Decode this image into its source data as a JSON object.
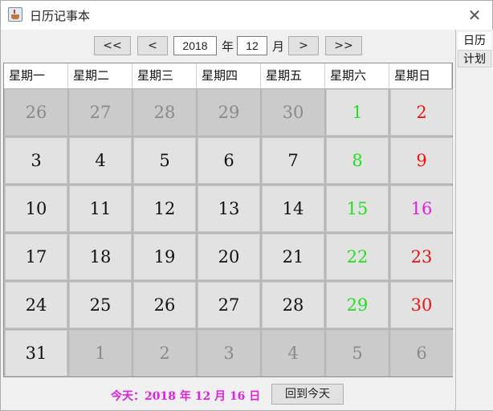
{
  "window": {
    "title": "日历记事本"
  },
  "nav": {
    "prev_year": "<<",
    "prev_month": "<",
    "year": "2018",
    "year_label": "年",
    "month": "12",
    "month_label": "月",
    "next_month": ">",
    "next_year": ">>"
  },
  "weekdays": [
    "星期一",
    "星期二",
    "星期三",
    "星期四",
    "星期五",
    "星期六",
    "星期日"
  ],
  "weeks": [
    [
      {
        "d": "26",
        "o": true
      },
      {
        "d": "27",
        "o": true
      },
      {
        "d": "28",
        "o": true
      },
      {
        "d": "29",
        "o": true
      },
      {
        "d": "30",
        "o": true
      },
      {
        "d": "1",
        "c": "#22e022"
      },
      {
        "d": "2",
        "c": "#ee1111"
      }
    ],
    [
      {
        "d": "3"
      },
      {
        "d": "4"
      },
      {
        "d": "5"
      },
      {
        "d": "6"
      },
      {
        "d": "7"
      },
      {
        "d": "8",
        "c": "#22e022"
      },
      {
        "d": "9",
        "c": "#ee1111"
      }
    ],
    [
      {
        "d": "10"
      },
      {
        "d": "11"
      },
      {
        "d": "12"
      },
      {
        "d": "13"
      },
      {
        "d": "14"
      },
      {
        "d": "15",
        "c": "#22e022"
      },
      {
        "d": "16",
        "c": "#e020e0"
      }
    ],
    [
      {
        "d": "17"
      },
      {
        "d": "18"
      },
      {
        "d": "19"
      },
      {
        "d": "20"
      },
      {
        "d": "21"
      },
      {
        "d": "22",
        "c": "#22e022"
      },
      {
        "d": "23",
        "c": "#ee1111"
      }
    ],
    [
      {
        "d": "24"
      },
      {
        "d": "25"
      },
      {
        "d": "26"
      },
      {
        "d": "27"
      },
      {
        "d": "28"
      },
      {
        "d": "29",
        "c": "#22e022"
      },
      {
        "d": "30",
        "c": "#ee1111"
      }
    ],
    [
      {
        "d": "31"
      },
      {
        "d": "1",
        "o": true
      },
      {
        "d": "2",
        "o": true
      },
      {
        "d": "3",
        "o": true
      },
      {
        "d": "4",
        "o": true
      },
      {
        "d": "5",
        "o": true
      },
      {
        "d": "6",
        "o": true
      }
    ]
  ],
  "footer": {
    "today_text": "今天：2018 年 12 月 16 日",
    "today_button": "回到今天"
  },
  "side_tabs": {
    "calendar": "日历",
    "plan": "计划"
  },
  "colors": {
    "saturday": "#22e022",
    "sunday": "#ee1111",
    "today": "#e020e0"
  }
}
